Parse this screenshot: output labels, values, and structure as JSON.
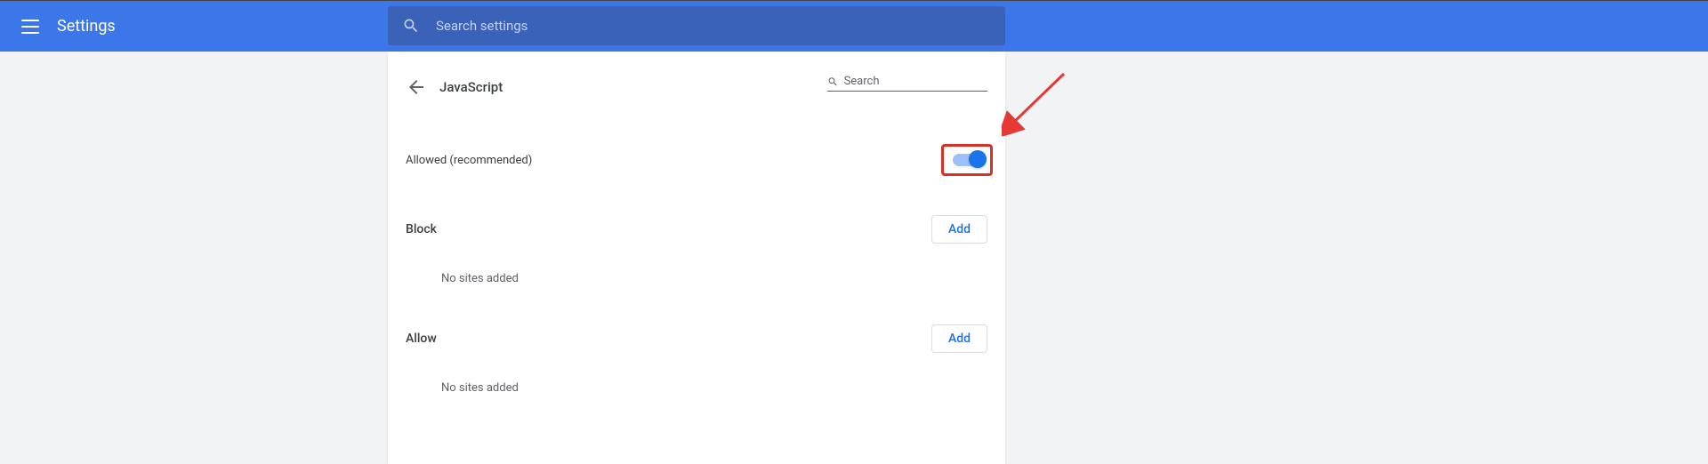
{
  "header": {
    "title": "Settings",
    "search_placeholder": "Search settings"
  },
  "panel": {
    "title": "JavaScript",
    "mini_search_placeholder": "Search",
    "allowed_label": "Allowed (recommended)",
    "toggle_on": true,
    "block": {
      "label": "Block",
      "add_label": "Add",
      "empty_text": "No sites added"
    },
    "allow": {
      "label": "Allow",
      "add_label": "Add",
      "empty_text": "No sites added"
    }
  }
}
